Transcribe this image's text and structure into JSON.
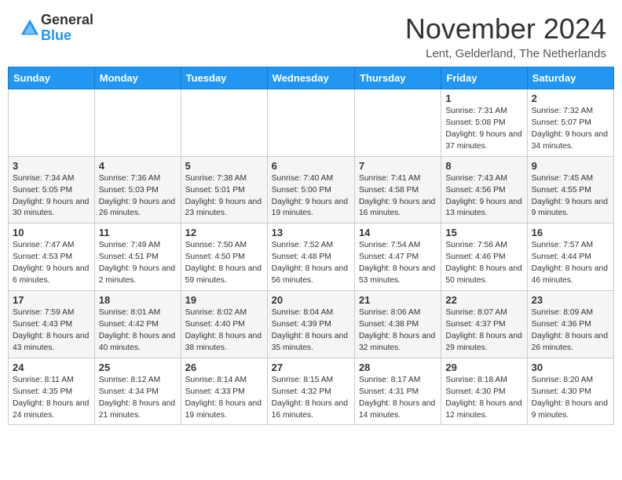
{
  "logo": {
    "general": "General",
    "blue": "Blue"
  },
  "header": {
    "month_title": "November 2024",
    "subtitle": "Lent, Gelderland, The Netherlands"
  },
  "days_of_week": [
    "Sunday",
    "Monday",
    "Tuesday",
    "Wednesday",
    "Thursday",
    "Friday",
    "Saturday"
  ],
  "weeks": [
    [
      {
        "day": "",
        "info": ""
      },
      {
        "day": "",
        "info": ""
      },
      {
        "day": "",
        "info": ""
      },
      {
        "day": "",
        "info": ""
      },
      {
        "day": "",
        "info": ""
      },
      {
        "day": "1",
        "info": "Sunrise: 7:31 AM\nSunset: 5:08 PM\nDaylight: 9 hours and 37 minutes."
      },
      {
        "day": "2",
        "info": "Sunrise: 7:32 AM\nSunset: 5:07 PM\nDaylight: 9 hours and 34 minutes."
      }
    ],
    [
      {
        "day": "3",
        "info": "Sunrise: 7:34 AM\nSunset: 5:05 PM\nDaylight: 9 hours and 30 minutes."
      },
      {
        "day": "4",
        "info": "Sunrise: 7:36 AM\nSunset: 5:03 PM\nDaylight: 9 hours and 26 minutes."
      },
      {
        "day": "5",
        "info": "Sunrise: 7:38 AM\nSunset: 5:01 PM\nDaylight: 9 hours and 23 minutes."
      },
      {
        "day": "6",
        "info": "Sunrise: 7:40 AM\nSunset: 5:00 PM\nDaylight: 9 hours and 19 minutes."
      },
      {
        "day": "7",
        "info": "Sunrise: 7:41 AM\nSunset: 4:58 PM\nDaylight: 9 hours and 16 minutes."
      },
      {
        "day": "8",
        "info": "Sunrise: 7:43 AM\nSunset: 4:56 PM\nDaylight: 9 hours and 13 minutes."
      },
      {
        "day": "9",
        "info": "Sunrise: 7:45 AM\nSunset: 4:55 PM\nDaylight: 9 hours and 9 minutes."
      }
    ],
    [
      {
        "day": "10",
        "info": "Sunrise: 7:47 AM\nSunset: 4:53 PM\nDaylight: 9 hours and 6 minutes."
      },
      {
        "day": "11",
        "info": "Sunrise: 7:49 AM\nSunset: 4:51 PM\nDaylight: 9 hours and 2 minutes."
      },
      {
        "day": "12",
        "info": "Sunrise: 7:50 AM\nSunset: 4:50 PM\nDaylight: 8 hours and 59 minutes."
      },
      {
        "day": "13",
        "info": "Sunrise: 7:52 AM\nSunset: 4:48 PM\nDaylight: 8 hours and 56 minutes."
      },
      {
        "day": "14",
        "info": "Sunrise: 7:54 AM\nSunset: 4:47 PM\nDaylight: 8 hours and 53 minutes."
      },
      {
        "day": "15",
        "info": "Sunrise: 7:56 AM\nSunset: 4:46 PM\nDaylight: 8 hours and 50 minutes."
      },
      {
        "day": "16",
        "info": "Sunrise: 7:57 AM\nSunset: 4:44 PM\nDaylight: 8 hours and 46 minutes."
      }
    ],
    [
      {
        "day": "17",
        "info": "Sunrise: 7:59 AM\nSunset: 4:43 PM\nDaylight: 8 hours and 43 minutes."
      },
      {
        "day": "18",
        "info": "Sunrise: 8:01 AM\nSunset: 4:42 PM\nDaylight: 8 hours and 40 minutes."
      },
      {
        "day": "19",
        "info": "Sunrise: 8:02 AM\nSunset: 4:40 PM\nDaylight: 8 hours and 38 minutes."
      },
      {
        "day": "20",
        "info": "Sunrise: 8:04 AM\nSunset: 4:39 PM\nDaylight: 8 hours and 35 minutes."
      },
      {
        "day": "21",
        "info": "Sunrise: 8:06 AM\nSunset: 4:38 PM\nDaylight: 8 hours and 32 minutes."
      },
      {
        "day": "22",
        "info": "Sunrise: 8:07 AM\nSunset: 4:37 PM\nDaylight: 8 hours and 29 minutes."
      },
      {
        "day": "23",
        "info": "Sunrise: 8:09 AM\nSunset: 4:36 PM\nDaylight: 8 hours and 26 minutes."
      }
    ],
    [
      {
        "day": "24",
        "info": "Sunrise: 8:11 AM\nSunset: 4:35 PM\nDaylight: 8 hours and 24 minutes."
      },
      {
        "day": "25",
        "info": "Sunrise: 8:12 AM\nSunset: 4:34 PM\nDaylight: 8 hours and 21 minutes."
      },
      {
        "day": "26",
        "info": "Sunrise: 8:14 AM\nSunset: 4:33 PM\nDaylight: 8 hours and 19 minutes."
      },
      {
        "day": "27",
        "info": "Sunrise: 8:15 AM\nSunset: 4:32 PM\nDaylight: 8 hours and 16 minutes."
      },
      {
        "day": "28",
        "info": "Sunrise: 8:17 AM\nSunset: 4:31 PM\nDaylight: 8 hours and 14 minutes."
      },
      {
        "day": "29",
        "info": "Sunrise: 8:18 AM\nSunset: 4:30 PM\nDaylight: 8 hours and 12 minutes."
      },
      {
        "day": "30",
        "info": "Sunrise: 8:20 AM\nSunset: 4:30 PM\nDaylight: 8 hours and 9 minutes."
      }
    ]
  ]
}
